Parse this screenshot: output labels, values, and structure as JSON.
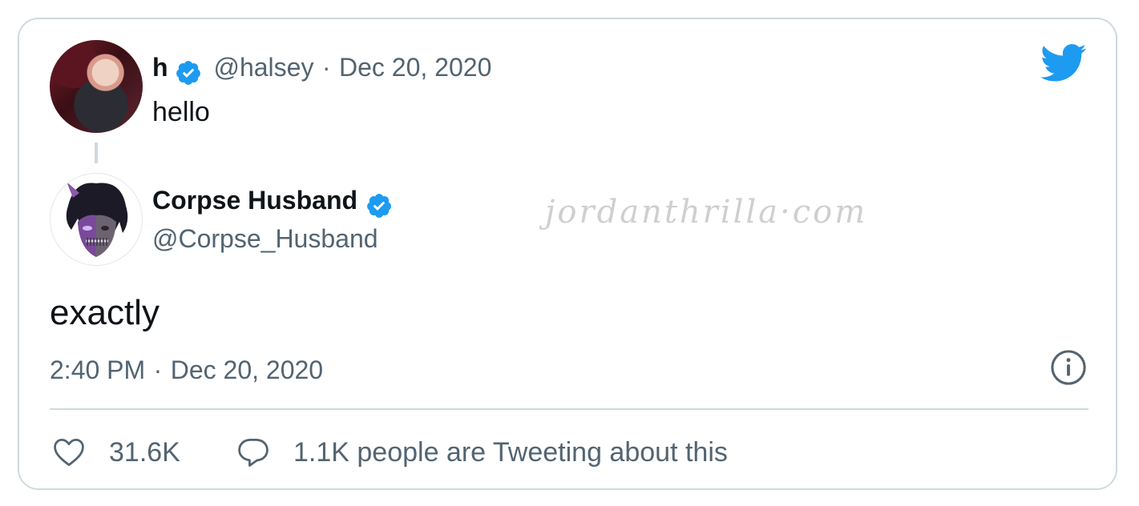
{
  "parent_tweet": {
    "display_name": "h",
    "handle": "@halsey",
    "separator": "·",
    "date": "Dec 20, 2020",
    "text": "hello"
  },
  "main_tweet": {
    "display_name": "Corpse Husband",
    "handle": "@Corpse_Husband",
    "text": "exactly",
    "time": "2:40 PM",
    "separator": "·",
    "date": "Dec 20, 2020"
  },
  "watermark": "jordanthrilla·com",
  "actions": {
    "likes_count": "31.6K",
    "conversation_text": "1.1K people are Tweeting about this"
  },
  "colors": {
    "verified_blue": "#1d9bf0",
    "twitter_blue": "#1d9bf0",
    "muted_text": "#536471",
    "border": "#cfd9de"
  },
  "icons": {
    "brand": "twitter-bird-icon",
    "verified": "verified-badge-icon",
    "info": "info-icon",
    "like": "heart-icon",
    "reply": "speech-bubble-icon"
  }
}
